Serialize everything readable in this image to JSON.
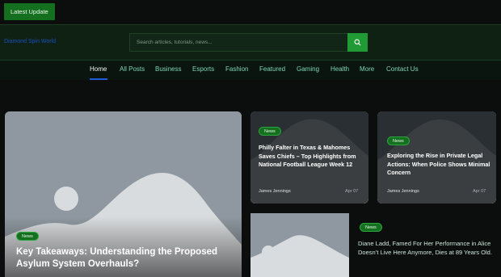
{
  "topbar": {
    "latest_label": "Latest Update"
  },
  "header": {
    "site_title": "Diamond Spin World",
    "search_placeholder": "Search articles, tutorials, news..."
  },
  "nav": {
    "items": [
      {
        "label": "Home",
        "active": true
      },
      {
        "label": "All Posts"
      },
      {
        "label": "Business"
      },
      {
        "label": "Esports"
      },
      {
        "label": "Fashion"
      },
      {
        "label": "Featured"
      },
      {
        "label": "Gaming"
      },
      {
        "label": "Health"
      },
      {
        "label": "More"
      },
      {
        "label": "Contact Us"
      }
    ]
  },
  "posts": {
    "hero": {
      "badge": "News",
      "title": "Key Takeaways: Understanding the Proposed Asylum System Overhauls?"
    },
    "card1": {
      "badge": "News",
      "title": "Philly Falter in Texas & Mahomes Saves Chiefs – Top Highlights from National Football League Week 12",
      "author": "James Jennings",
      "date": "Apr 07"
    },
    "card2": {
      "badge": "News",
      "title": "Exploring the Rise in Private Legal Actions: When Police Shows Minimal Concern",
      "author": "James Jennings",
      "date": "Apr 07"
    },
    "card3": {
      "badge": "News",
      "title": "Diane Ladd, Famed For Her Performance in Alice Doesn’t Live Here Anymore, Dies at 89 Years Old."
    }
  },
  "colors": {
    "accent_green": "#14701f",
    "search_green": "#1f9a34",
    "nav_text": "#7bd6b6",
    "underline_blue": "#1f5cd9"
  },
  "icons": {
    "search_button": "search-icon"
  }
}
